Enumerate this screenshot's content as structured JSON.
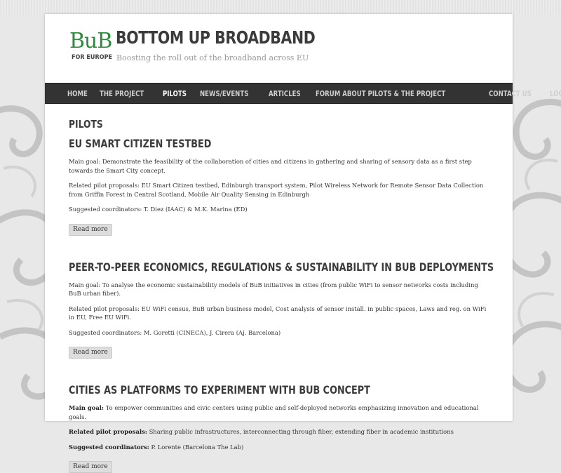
{
  "site": {
    "logo_main": "BuB",
    "logo_sub": "FOR EUROPE",
    "title": "BOTTOM UP BROADBAND",
    "tagline": "Boosting the roll out of the broadband across EU"
  },
  "colors": {
    "brand_green": "#2e8b3c",
    "nav_bg": "#333333",
    "page_bg": "#e8e8e8"
  },
  "nav": {
    "items": [
      {
        "label": "HOME"
      },
      {
        "label": "THE PROJECT"
      },
      {
        "label": "PILOTS"
      },
      {
        "label": "NEWS/EVENTS"
      },
      {
        "label": "ARTICLES"
      },
      {
        "label": "FORUM ABOUT PILOTS & THE PROJECT"
      },
      {
        "label": "CONTACT US"
      },
      {
        "label": "LOGIN"
      }
    ]
  },
  "page_heading": "PILOTS",
  "articles": [
    {
      "title": "EU SMART CITIZEN TESTBED",
      "goal_label": "Main goal:",
      "goal": "Demonstrate the feasibility of the collaboration of cities and citizens in gathering and sharing of sensory data as a first step towards the Smart City concept.",
      "proposals_label": "Related pilot proposals:",
      "proposals": "EU Smart Citizen testbed, Edinburgh transport system, Pilot Wireless Network for Remote Sensor Data Collection from Griffin Forest in Central Scotland, Mobile Air Quality Sensing in Edinburgh",
      "coordinators_label": "Suggested coordinators:",
      "coordinators": "T. Diez (IAAC) & M.K. Marina (ED)",
      "read_more": "Read more"
    },
    {
      "title": "PEER-TO-PEER ECONOMICS, REGULATIONS & SUSTAINABILITY IN BUB DEPLOYMENTS",
      "goal_label": "Main goal:",
      "goal": "To analyse the economic sustainability models of BuB initiatives in cities (from public WiFi to sensor networks costs including BuB urban fiber).",
      "proposals_label": "Related pilot proposals:",
      "proposals": "EU WiFi census, BuB urban business model, Cost analysis of sensor install. in public spaces, Laws and reg. on WiFi in EU, Free EU WiFi.",
      "coordinators_label": "Suggested coordinators:",
      "coordinators": "M. Goretti (CINECA), J. Cirera (Aj. Barcelona)",
      "read_more": "Read more"
    },
    {
      "title": "CITIES AS PLATFORMS TO EXPERIMENT WITH BUB CONCEPT",
      "goal_label": "Main goal:",
      "goal": "To empower communities and civic centers using public and self-deployed networks emphasizing innovation and educational goals.",
      "proposals_label": "Related pilot proposals:",
      "proposals": "Sharing public infrastructures, interconnecting through fiber, extending fiber in academic institutions",
      "coordinators_label": "Suggested coordinators:",
      "coordinators": "P. Lorente (Barcelona The Lab)",
      "read_more": "Read more"
    }
  ]
}
